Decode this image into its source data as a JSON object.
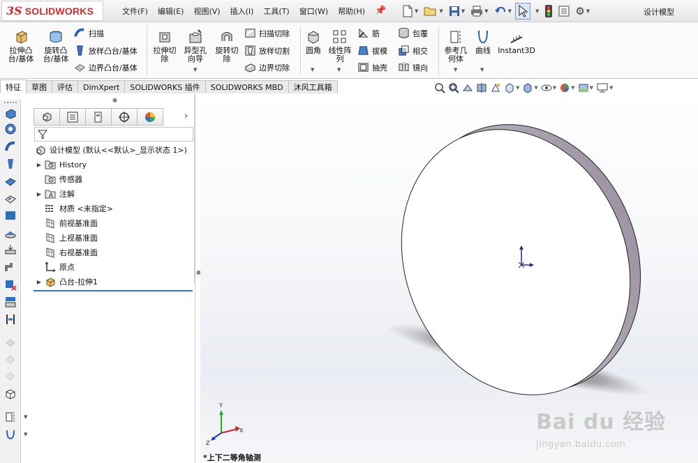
{
  "app": {
    "logo_mark": "3S",
    "logo_text": "SOLIDWORKS",
    "document_title": "设计模型"
  },
  "menu": [
    "文件(F)",
    "编辑(E)",
    "视图(V)",
    "插入(I)",
    "工具(T)",
    "窗口(W)",
    "帮助(H)"
  ],
  "ribbon": {
    "extrude_boss": "拉伸凸\n台/基体",
    "revolve_boss": "旋转凸\n台/基体",
    "sweep": "扫描",
    "loft_boss": "放样凸台/基体",
    "boundary_boss": "边界凸台/基体",
    "extrude_cut": "拉伸切\n除",
    "hole_wizard": "异型孔\n向导",
    "revolve_cut": "旋转切\n除",
    "sweep_cut": "扫描切除",
    "loft_cut": "放样切割",
    "boundary_cut": "边界切除",
    "fillet": "圆角",
    "linear_pattern": "线性阵\n列",
    "rib": "筋",
    "draft": "拔模",
    "shell": "抽壳",
    "wrap": "包覆",
    "intersect": "相交",
    "mirror": "镜向",
    "reference_geometry": "参考几\n何体",
    "curves": "曲线",
    "instant3d": "Instant3D"
  },
  "tabs": [
    "特征",
    "草图",
    "评估",
    "DimXpert",
    "SOLIDWORKS 插件",
    "SOLIDWORKS MBD",
    "沐风工具箱"
  ],
  "active_tab": "特征",
  "feature_tree": {
    "root": "设计模型  (默认<<默认>_显示状态 1>)",
    "items": [
      {
        "label": "History",
        "expandable": true
      },
      {
        "label": "传感器",
        "expandable": false
      },
      {
        "label": "注解",
        "expandable": true
      },
      {
        "label": "材质 <未指定>",
        "expandable": false
      },
      {
        "label": "前视基准面",
        "expandable": false
      },
      {
        "label": "上视基准面",
        "expandable": false
      },
      {
        "label": "右视基准面",
        "expandable": false
      },
      {
        "label": "原点",
        "expandable": false
      },
      {
        "label": "凸台-拉伸1",
        "expandable": true
      }
    ]
  },
  "viewport": {
    "view_name": "*上下二等角轴测",
    "triad_labels": {
      "x": "X",
      "y": "Y",
      "z": "Z"
    },
    "watermark": "Bai du 经验",
    "watermark_url": "jingyan.baidu.com"
  },
  "colors": {
    "brand": "#d62b2b",
    "selection": "#3a6fc4",
    "axis_x": "#cc2222",
    "axis_y": "#22aa22",
    "axis_z": "#2233cc"
  }
}
